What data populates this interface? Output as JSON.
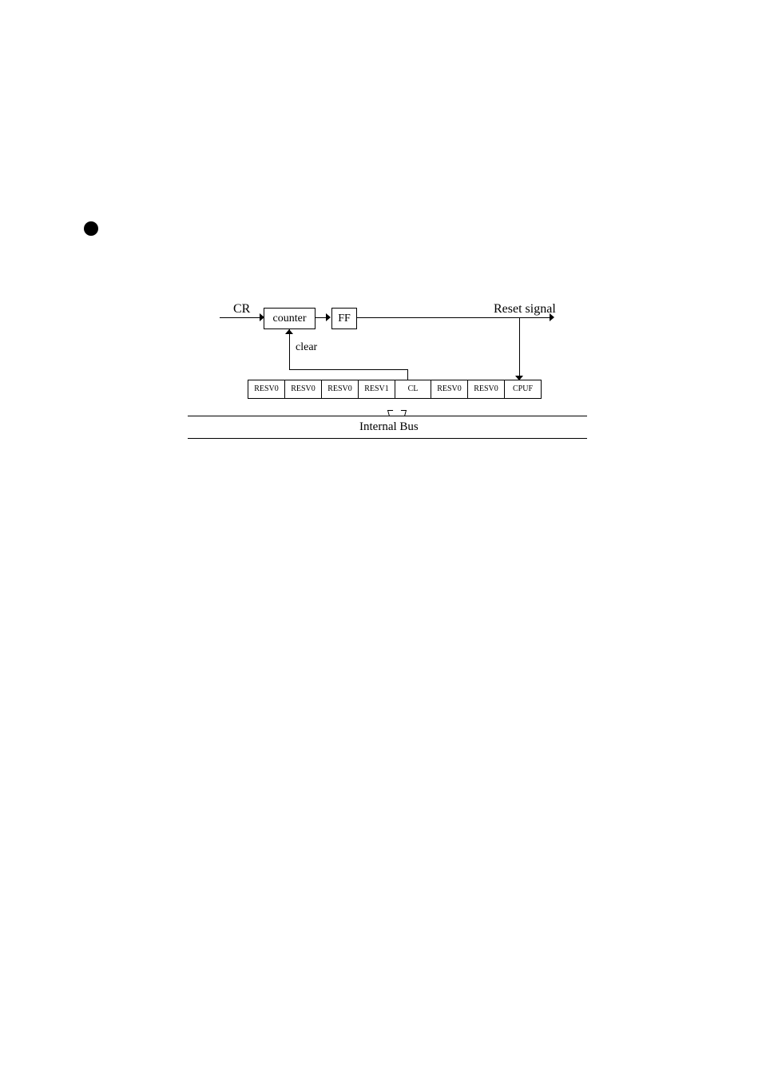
{
  "labels": {
    "cr": "CR",
    "counter": "counter",
    "ff": "FF",
    "reset": "Reset signal",
    "clear": "clear",
    "bus": "Internal Bus"
  },
  "register": {
    "c0": "RESV0",
    "c1": "RESV0",
    "c2": "RESV0",
    "c3": "RESV1",
    "c4": "CL",
    "c5": "RESV0",
    "c6": "RESV0",
    "c7": "CPUF"
  }
}
